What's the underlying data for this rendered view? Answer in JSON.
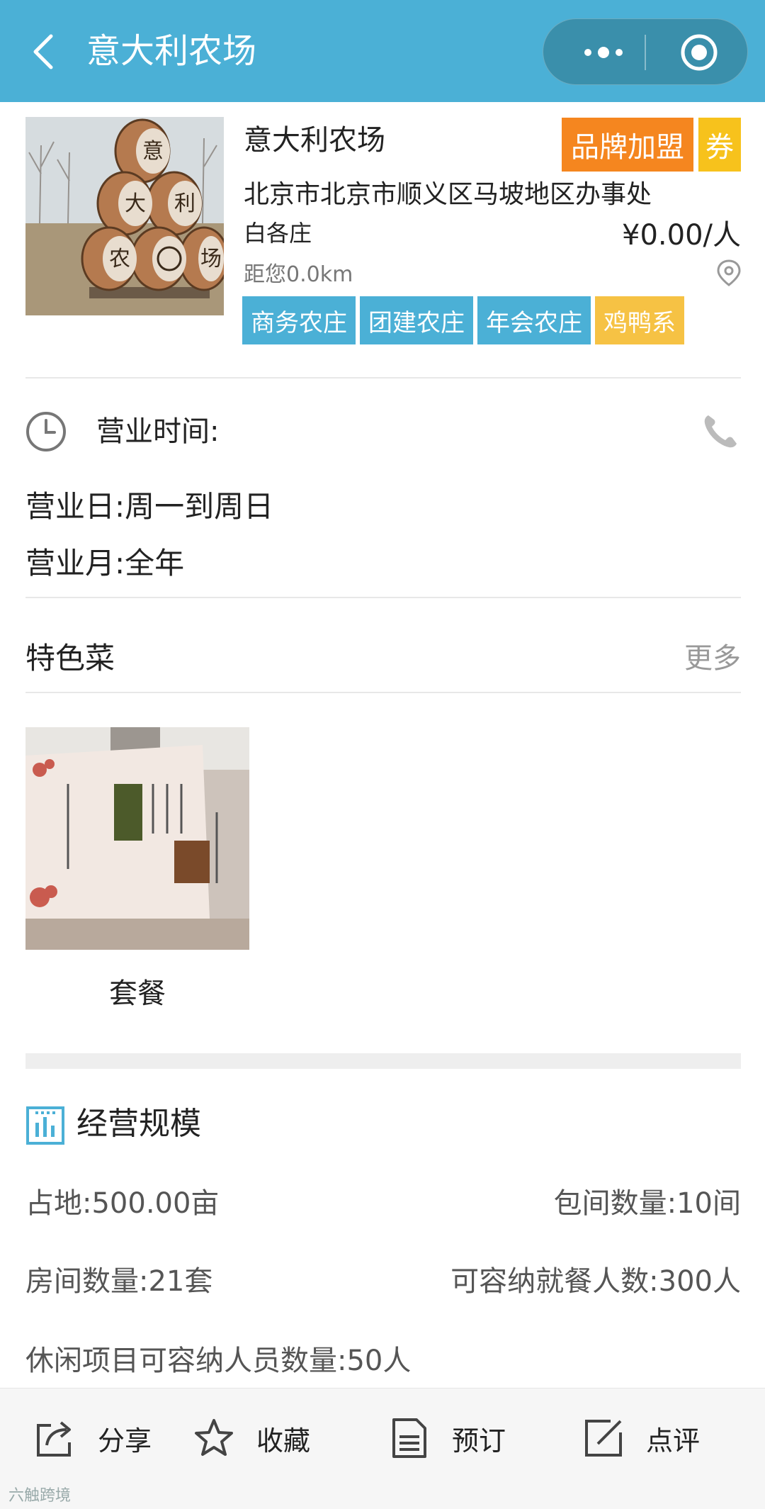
{
  "header": {
    "back_icon": "chevron-left-icon",
    "title": "意大利农场",
    "more_icon": "more-dots-icon",
    "close_icon": "target-close-icon",
    "bg_color": "#4bb0d6"
  },
  "farm": {
    "name": "意大利农场",
    "brand_badge": "品牌加盟",
    "coupon_badge": "券",
    "address_line1": "北京市北京市顺义区马坡地区办事处",
    "address_line2": "白各庄",
    "price": "¥0.00/人",
    "distance": "距您0.0km",
    "tags": [
      {
        "label": "商务农庄",
        "color": "#4bb0d6"
      },
      {
        "label": "团建农庄",
        "color": "#4bb0d6"
      },
      {
        "label": "年会农庄",
        "color": "#4bb0d6"
      },
      {
        "label": "鸡鸭系",
        "color": "#f6c244"
      }
    ],
    "sign_chars": [
      "意",
      "大",
      "利",
      "农",
      "场"
    ]
  },
  "hours": {
    "title": "营业时间:",
    "days": "营业日:周一到周日",
    "months": "营业月:全年"
  },
  "specialty": {
    "title": "特色菜",
    "more": "更多",
    "dishes": [
      {
        "name": "套餐"
      }
    ]
  },
  "scale": {
    "title": "经营规模",
    "area": "占地:500.00亩",
    "private_rooms": "包间数量:10间",
    "rooms": "房间数量:21套",
    "dining_capacity": "可容纳就餐人数:300人",
    "leisure_capacity": "休闲项目可容纳人员数量:50人"
  },
  "bottom_bar": {
    "share": "分享",
    "favorite": "收藏",
    "book": "预订",
    "review": "点评"
  },
  "watermark": "六触跨境"
}
